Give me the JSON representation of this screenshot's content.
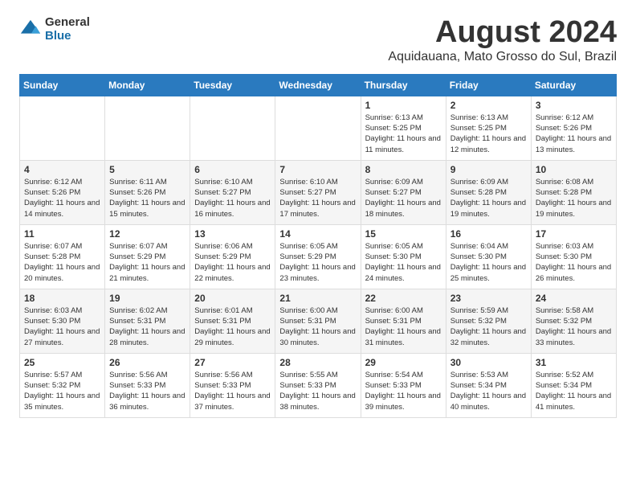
{
  "logo": {
    "general": "General",
    "blue": "Blue"
  },
  "title": {
    "month": "August 2024",
    "location": "Aquidauana, Mato Grosso do Sul, Brazil"
  },
  "weekdays": [
    "Sunday",
    "Monday",
    "Tuesday",
    "Wednesday",
    "Thursday",
    "Friday",
    "Saturday"
  ],
  "weeks": [
    [
      {
        "day": "",
        "info": ""
      },
      {
        "day": "",
        "info": ""
      },
      {
        "day": "",
        "info": ""
      },
      {
        "day": "",
        "info": ""
      },
      {
        "day": "1",
        "info": "Sunrise: 6:13 AM\nSunset: 5:25 PM\nDaylight: 11 hours and 11 minutes."
      },
      {
        "day": "2",
        "info": "Sunrise: 6:13 AM\nSunset: 5:25 PM\nDaylight: 11 hours and 12 minutes."
      },
      {
        "day": "3",
        "info": "Sunrise: 6:12 AM\nSunset: 5:26 PM\nDaylight: 11 hours and 13 minutes."
      }
    ],
    [
      {
        "day": "4",
        "info": "Sunrise: 6:12 AM\nSunset: 5:26 PM\nDaylight: 11 hours and 14 minutes."
      },
      {
        "day": "5",
        "info": "Sunrise: 6:11 AM\nSunset: 5:26 PM\nDaylight: 11 hours and 15 minutes."
      },
      {
        "day": "6",
        "info": "Sunrise: 6:10 AM\nSunset: 5:27 PM\nDaylight: 11 hours and 16 minutes."
      },
      {
        "day": "7",
        "info": "Sunrise: 6:10 AM\nSunset: 5:27 PM\nDaylight: 11 hours and 17 minutes."
      },
      {
        "day": "8",
        "info": "Sunrise: 6:09 AM\nSunset: 5:27 PM\nDaylight: 11 hours and 18 minutes."
      },
      {
        "day": "9",
        "info": "Sunrise: 6:09 AM\nSunset: 5:28 PM\nDaylight: 11 hours and 19 minutes."
      },
      {
        "day": "10",
        "info": "Sunrise: 6:08 AM\nSunset: 5:28 PM\nDaylight: 11 hours and 19 minutes."
      }
    ],
    [
      {
        "day": "11",
        "info": "Sunrise: 6:07 AM\nSunset: 5:28 PM\nDaylight: 11 hours and 20 minutes."
      },
      {
        "day": "12",
        "info": "Sunrise: 6:07 AM\nSunset: 5:29 PM\nDaylight: 11 hours and 21 minutes."
      },
      {
        "day": "13",
        "info": "Sunrise: 6:06 AM\nSunset: 5:29 PM\nDaylight: 11 hours and 22 minutes."
      },
      {
        "day": "14",
        "info": "Sunrise: 6:05 AM\nSunset: 5:29 PM\nDaylight: 11 hours and 23 minutes."
      },
      {
        "day": "15",
        "info": "Sunrise: 6:05 AM\nSunset: 5:30 PM\nDaylight: 11 hours and 24 minutes."
      },
      {
        "day": "16",
        "info": "Sunrise: 6:04 AM\nSunset: 5:30 PM\nDaylight: 11 hours and 25 minutes."
      },
      {
        "day": "17",
        "info": "Sunrise: 6:03 AM\nSunset: 5:30 PM\nDaylight: 11 hours and 26 minutes."
      }
    ],
    [
      {
        "day": "18",
        "info": "Sunrise: 6:03 AM\nSunset: 5:30 PM\nDaylight: 11 hours and 27 minutes."
      },
      {
        "day": "19",
        "info": "Sunrise: 6:02 AM\nSunset: 5:31 PM\nDaylight: 11 hours and 28 minutes."
      },
      {
        "day": "20",
        "info": "Sunrise: 6:01 AM\nSunset: 5:31 PM\nDaylight: 11 hours and 29 minutes."
      },
      {
        "day": "21",
        "info": "Sunrise: 6:00 AM\nSunset: 5:31 PM\nDaylight: 11 hours and 30 minutes."
      },
      {
        "day": "22",
        "info": "Sunrise: 6:00 AM\nSunset: 5:31 PM\nDaylight: 11 hours and 31 minutes."
      },
      {
        "day": "23",
        "info": "Sunrise: 5:59 AM\nSunset: 5:32 PM\nDaylight: 11 hours and 32 minutes."
      },
      {
        "day": "24",
        "info": "Sunrise: 5:58 AM\nSunset: 5:32 PM\nDaylight: 11 hours and 33 minutes."
      }
    ],
    [
      {
        "day": "25",
        "info": "Sunrise: 5:57 AM\nSunset: 5:32 PM\nDaylight: 11 hours and 35 minutes."
      },
      {
        "day": "26",
        "info": "Sunrise: 5:56 AM\nSunset: 5:33 PM\nDaylight: 11 hours and 36 minutes."
      },
      {
        "day": "27",
        "info": "Sunrise: 5:56 AM\nSunset: 5:33 PM\nDaylight: 11 hours and 37 minutes."
      },
      {
        "day": "28",
        "info": "Sunrise: 5:55 AM\nSunset: 5:33 PM\nDaylight: 11 hours and 38 minutes."
      },
      {
        "day": "29",
        "info": "Sunrise: 5:54 AM\nSunset: 5:33 PM\nDaylight: 11 hours and 39 minutes."
      },
      {
        "day": "30",
        "info": "Sunrise: 5:53 AM\nSunset: 5:34 PM\nDaylight: 11 hours and 40 minutes."
      },
      {
        "day": "31",
        "info": "Sunrise: 5:52 AM\nSunset: 5:34 PM\nDaylight: 11 hours and 41 minutes."
      }
    ]
  ]
}
